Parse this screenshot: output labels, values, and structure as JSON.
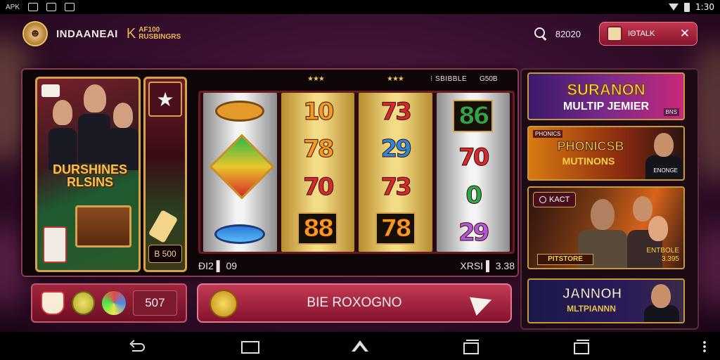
{
  "status_bar": {
    "app_label": "APK",
    "time": "1:30"
  },
  "header": {
    "logo_glyph": "☻",
    "brand": "INDAANEAI",
    "brand_k": "K",
    "brand_tag": "AF100 RUSBINGRS",
    "balance": "82020",
    "wallet_label": "ΙΘΤΑLΚ",
    "wallet_close": "✕"
  },
  "game": {
    "promo_title": "DURSHINES RLSINS",
    "star_glyph": "★",
    "star_prize": "B 500",
    "hud": {
      "stars_a": "★★★",
      "stars_b": "★★★",
      "info_a": "⁝ SBIBBLE",
      "info_b": "G50B"
    },
    "reels": [
      {
        "style": "silver",
        "symbols": [
          {
            "kind": "bowl"
          },
          {
            "kind": "kite"
          },
          {
            "kind": "wave"
          }
        ]
      },
      {
        "style": "gold",
        "symbols": [
          {
            "text": "10",
            "color": "orange"
          },
          {
            "text": "78",
            "color": "orange"
          },
          {
            "text": "70",
            "color": "red"
          },
          {
            "text": "88",
            "color": "orange",
            "boxed": true
          }
        ]
      },
      {
        "style": "gold",
        "symbols": [
          {
            "text": "73",
            "color": "red"
          },
          {
            "text": "29",
            "color": "blue"
          },
          {
            "text": "73",
            "color": "red"
          },
          {
            "text": "78",
            "color": "orange",
            "boxed": true
          }
        ]
      },
      {
        "style": "silver",
        "symbols": [
          {
            "text": "86",
            "color": "green",
            "boxed": true
          },
          {
            "text": "70",
            "color": "red"
          },
          {
            "text": "0",
            "color": "green"
          },
          {
            "text": "29",
            "color": "purple"
          }
        ]
      }
    ],
    "footer_left": "ĐI2 ▌ 09",
    "footer_right": "XRSI ▌ 3.38"
  },
  "controls": {
    "bet_value": "507",
    "spin_label": "BIE ROXOGNO"
  },
  "sidebar": {
    "banners": [
      {
        "title": "SURANON",
        "subtitle": "MULTIP JEMIER",
        "tag": "BNS"
      },
      {
        "title": "PHONICSB",
        "subtitle": "MUTINONS",
        "tag": "PHONICS",
        "tag2": "ENONGE"
      },
      {
        "badge": "KACT",
        "title": "PITSTORE",
        "subtitle": "ENTBOLE 3.395"
      },
      {
        "title": "JANNOH",
        "subtitle": "MLTPIANNN"
      }
    ]
  },
  "colors": {
    "accent": "#c23a55",
    "gold": "#d8a24a",
    "background": "#3a1030"
  }
}
